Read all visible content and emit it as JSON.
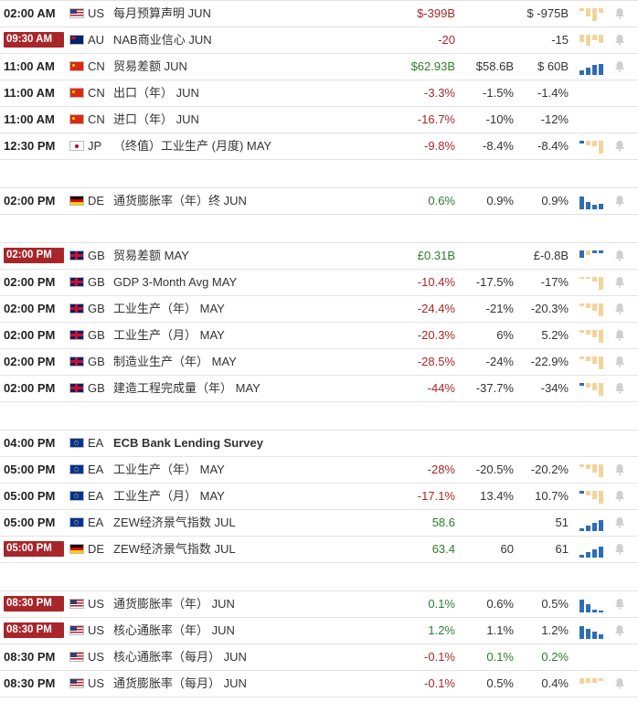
{
  "colors": {
    "negative": "#a8262a",
    "positive": "#2d7d2d",
    "highlight_time_bg": "#a8262a",
    "bar_blue": "#2f6db3",
    "bar_yellow": "#f4d39a"
  },
  "groups": [
    {
      "rows": [
        {
          "time": "02:00 AM",
          "highlight": false,
          "flag": "us",
          "country": "US",
          "event": "每月预算声明 JUN",
          "actual": "$-399B",
          "actual_tone": "neg",
          "forecast": "",
          "previous": "$ -975B",
          "chart": "mix-down",
          "bars": [
            0.2,
            0.6,
            0.9,
            0.3
          ],
          "bar_colors": [
            "y",
            "y",
            "y",
            "y"
          ],
          "neg_bars": true,
          "bell": true
        },
        {
          "time": "09:30 AM",
          "highlight": true,
          "flag": "au",
          "country": "AU",
          "event": "NAB商业信心 JUN",
          "actual": "-20",
          "actual_tone": "neg",
          "forecast": "",
          "previous": "-15",
          "chart": "y",
          "bars": [
            0.5,
            0.8,
            0.4,
            0.6
          ],
          "bar_colors": [
            "y",
            "y",
            "y",
            "y"
          ],
          "neg_bars": true,
          "bell": true
        },
        {
          "time": "11:00 AM",
          "highlight": false,
          "flag": "cn",
          "country": "CN",
          "event": "贸易差额 JUN",
          "actual": "$62.93B",
          "actual_tone": "pos",
          "forecast": "$58.6B",
          "previous": "$ 60B",
          "chart": "b",
          "bars": [
            0.3,
            0.5,
            0.7,
            0.8
          ],
          "bar_colors": [
            "b",
            "b",
            "b",
            "b"
          ],
          "neg_bars": false,
          "bell": true
        },
        {
          "time": "11:00 AM",
          "highlight": false,
          "flag": "cn",
          "country": "CN",
          "event": "出口（年） JUN",
          "actual": "-3.3%",
          "actual_tone": "neg",
          "forecast": "-1.5%",
          "previous": "-1.4%",
          "chart": "none",
          "bars": [],
          "bar_colors": [],
          "neg_bars": false,
          "bell": false
        },
        {
          "time": "11:00 AM",
          "highlight": false,
          "flag": "cn",
          "country": "CN",
          "event": "进口（年） JUN",
          "actual": "-16.7%",
          "actual_tone": "neg",
          "forecast": "-10%",
          "previous": "-12%",
          "chart": "none",
          "bars": [],
          "bar_colors": [],
          "neg_bars": false,
          "bell": false
        },
        {
          "time": "12:30 PM",
          "highlight": false,
          "flag": "jp",
          "country": "JP",
          "event": "（终值）工业生产 (月度) MAY",
          "actual": "-9.8%",
          "actual_tone": "neg",
          "forecast": "-8.4%",
          "previous": "-8.4%",
          "chart": "mix",
          "bars": [
            0.2,
            0.3,
            0.4,
            0.9
          ],
          "bar_colors": [
            "b",
            "y",
            "y",
            "y"
          ],
          "neg_bars": true,
          "bell": true
        }
      ]
    },
    {
      "rows": [
        {
          "time": "02:00 PM",
          "highlight": false,
          "flag": "de",
          "country": "DE",
          "event": "通货膨胀率（年）终 JUN",
          "actual": "0.6%",
          "actual_tone": "pos",
          "forecast": "0.9%",
          "previous": "0.9%",
          "chart": "b",
          "bars": [
            0.9,
            0.5,
            0.3,
            0.4
          ],
          "bar_colors": [
            "b",
            "b",
            "b",
            "b"
          ],
          "neg_bars": false,
          "bell": true
        }
      ]
    },
    {
      "rows": [
        {
          "time": "02:00 PM",
          "highlight": true,
          "flag": "gb",
          "country": "GB",
          "event": "贸易差额 MAY",
          "actual": "£0.31B",
          "actual_tone": "pos",
          "forecast": "",
          "previous": "£-0.8B",
          "chart": "mix",
          "bars": [
            0.5,
            0.3,
            0.2,
            0.2
          ],
          "bar_colors": [
            "b",
            "y",
            "b",
            "b"
          ],
          "neg_bars": true,
          "bell": true
        },
        {
          "time": "02:00 PM",
          "highlight": false,
          "flag": "gb",
          "country": "GB",
          "event": "GDP 3-Month Avg MAY",
          "actual": "-10.4%",
          "actual_tone": "neg",
          "forecast": "-17.5%",
          "previous": "-17%",
          "chart": "y",
          "bars": [
            0.1,
            0.1,
            0.3,
            0.9
          ],
          "bar_colors": [
            "y",
            "y",
            "y",
            "y"
          ],
          "neg_bars": true,
          "bell": true
        },
        {
          "time": "02:00 PM",
          "highlight": false,
          "flag": "gb",
          "country": "GB",
          "event": "工业生产（年） MAY",
          "actual": "-24.4%",
          "actual_tone": "neg",
          "forecast": "-21%",
          "previous": "-20.3%",
          "chart": "y",
          "bars": [
            0.2,
            0.3,
            0.5,
            0.9
          ],
          "bar_colors": [
            "y",
            "y",
            "y",
            "y"
          ],
          "neg_bars": true,
          "bell": true
        },
        {
          "time": "02:00 PM",
          "highlight": false,
          "flag": "gb",
          "country": "GB",
          "event": "工业生产（月） MAY",
          "actual": "-20.3%",
          "actual_tone": "neg",
          "forecast": "6%",
          "previous": "5.2%",
          "chart": "y",
          "bars": [
            0.2,
            0.3,
            0.5,
            0.9
          ],
          "bar_colors": [
            "y",
            "y",
            "y",
            "y"
          ],
          "neg_bars": true,
          "bell": true
        },
        {
          "time": "02:00 PM",
          "highlight": false,
          "flag": "gb",
          "country": "GB",
          "event": "制造业生产（年） MAY",
          "actual": "-28.5%",
          "actual_tone": "neg",
          "forecast": "-24%",
          "previous": "-22.9%",
          "chart": "y",
          "bars": [
            0.2,
            0.3,
            0.5,
            0.9
          ],
          "bar_colors": [
            "y",
            "y",
            "y",
            "y"
          ],
          "neg_bars": true,
          "bell": true
        },
        {
          "time": "02:00 PM",
          "highlight": false,
          "flag": "gb",
          "country": "GB",
          "event": "建造工程完成量（年） MAY",
          "actual": "-44%",
          "actual_tone": "neg",
          "forecast": "-37.7%",
          "previous": "-34%",
          "chart": "y",
          "bars": [
            0.2,
            0.3,
            0.5,
            0.9
          ],
          "bar_colors": [
            "b",
            "y",
            "y",
            "y"
          ],
          "neg_bars": true,
          "bell": true
        }
      ]
    },
    {
      "rows": [
        {
          "time": "04:00 PM",
          "highlight": false,
          "flag": "ea",
          "country": "EA",
          "event": "ECB Bank Lending Survey",
          "event_bold": true,
          "actual": "",
          "actual_tone": "neutral",
          "forecast": "",
          "previous": "",
          "chart": "none",
          "bars": [],
          "bar_colors": [],
          "neg_bars": false,
          "bell": false
        },
        {
          "time": "05:00 PM",
          "highlight": false,
          "flag": "ea",
          "country": "EA",
          "event": "工业生产（年） MAY",
          "actual": "-28%",
          "actual_tone": "neg",
          "forecast": "-20.5%",
          "previous": "-20.2%",
          "chart": "y",
          "bars": [
            0.2,
            0.3,
            0.6,
            0.9
          ],
          "bar_colors": [
            "y",
            "y",
            "y",
            "y"
          ],
          "neg_bars": true,
          "bell": true
        },
        {
          "time": "05:00 PM",
          "highlight": false,
          "flag": "ea",
          "country": "EA",
          "event": "工业生产（月） MAY",
          "actual": "-17.1%",
          "actual_tone": "neg",
          "forecast": "13.4%",
          "previous": "10.7%",
          "chart": "y",
          "bars": [
            0.2,
            0.3,
            0.6,
            0.9
          ],
          "bar_colors": [
            "b",
            "y",
            "y",
            "y"
          ],
          "neg_bars": true,
          "bell": true
        },
        {
          "time": "05:00 PM",
          "highlight": false,
          "flag": "ea",
          "country": "EA",
          "event": "ZEW经济景气指数 JUL",
          "actual": "58.6",
          "actual_tone": "pos",
          "forecast": "",
          "previous": "51",
          "chart": "b",
          "bars": [
            0.2,
            0.4,
            0.6,
            0.8
          ],
          "bar_colors": [
            "b",
            "b",
            "b",
            "b"
          ],
          "neg_bars": false,
          "bell": true
        },
        {
          "time": "05:00 PM",
          "highlight": true,
          "flag": "de",
          "country": "DE",
          "event": "ZEW经济景气指数 JUL",
          "actual": "63.4",
          "actual_tone": "pos",
          "forecast": "60",
          "previous": "61",
          "chart": "b",
          "bars": [
            0.2,
            0.4,
            0.6,
            0.8
          ],
          "bar_colors": [
            "b",
            "b",
            "b",
            "b"
          ],
          "neg_bars": false,
          "bell": true
        }
      ]
    },
    {
      "rows": [
        {
          "time": "08:30 PM",
          "highlight": true,
          "flag": "us",
          "country": "US",
          "event": "通货膨胀率（年） JUN",
          "actual": "0.1%",
          "actual_tone": "pos",
          "forecast": "0.6%",
          "previous": "0.5%",
          "chart": "b",
          "bars": [
            0.9,
            0.6,
            0.2,
            0.1
          ],
          "bar_colors": [
            "b",
            "b",
            "b",
            "b"
          ],
          "neg_bars": false,
          "bell": true
        },
        {
          "time": "08:30 PM",
          "highlight": true,
          "flag": "us",
          "country": "US",
          "event": "核心通胀率（年） JUN",
          "actual": "1.2%",
          "actual_tone": "pos",
          "forecast": "1.1%",
          "previous": "1.2%",
          "chart": "b",
          "bars": [
            0.9,
            0.7,
            0.5,
            0.3
          ],
          "bar_colors": [
            "b",
            "b",
            "b",
            "b"
          ],
          "neg_bars": false,
          "bell": true
        },
        {
          "time": "08:30 PM",
          "highlight": false,
          "flag": "us",
          "country": "US",
          "event": "核心通胀率（每月） JUN",
          "actual": "-0.1%",
          "actual_tone": "neg",
          "forecast": "0.1%",
          "forecast_tone": "pos",
          "previous": "0.2%",
          "previous_tone": "pos",
          "chart": "none",
          "bars": [],
          "bar_colors": [],
          "neg_bars": false,
          "bell": false
        },
        {
          "time": "08:30 PM",
          "highlight": false,
          "flag": "us",
          "country": "US",
          "event": "通货膨胀率（每月） JUN",
          "actual": "-0.1%",
          "actual_tone": "neg",
          "forecast": "0.5%",
          "previous": "0.4%",
          "chart": "mix",
          "bars": [
            0.4,
            0.3,
            0.3,
            0.2
          ],
          "bar_colors": [
            "y",
            "y",
            "y",
            "y"
          ],
          "neg_bars": true,
          "bell": true
        }
      ]
    }
  ]
}
